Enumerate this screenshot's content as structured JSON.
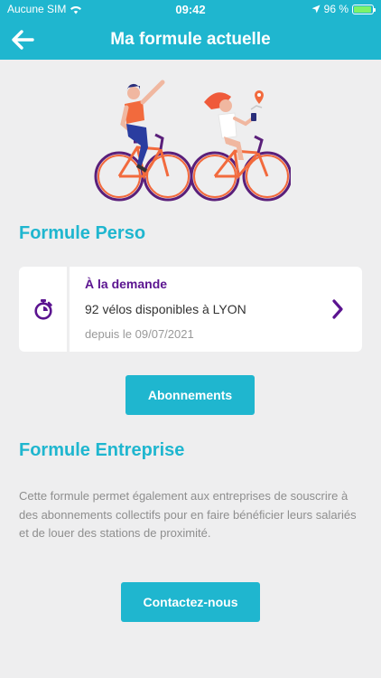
{
  "status_bar": {
    "carrier": "Aucune SIM",
    "time": "09:42",
    "battery": "96 %"
  },
  "header": {
    "title": "Ma formule actuelle",
    "back_icon": "arrow-left-icon"
  },
  "formule_perso": {
    "title": "Formule Perso",
    "card": {
      "type": "À la demande",
      "bikes": "92 vélos disponibles à LYON",
      "since": "depuis le 09/07/2021",
      "icon": "stopwatch-icon"
    },
    "button_label": "Abonnements"
  },
  "formule_entreprise": {
    "title": "Formule Entreprise",
    "description": "Cette formule permet également aux entreprises de souscrire à des abonnements collectifs pour en faire bénéficier leurs salariés et de louer des stations de proximité.",
    "button_label": "Contactez-nous"
  },
  "colors": {
    "accent": "#1fb6cf",
    "purple": "#5b1490",
    "background": "#eeeeef"
  }
}
